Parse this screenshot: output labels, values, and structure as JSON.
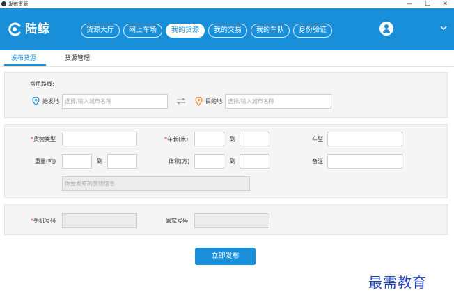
{
  "window": {
    "title": "发布货源",
    "minimize": "—",
    "maximize": "☐",
    "close": "✕"
  },
  "header": {
    "logo_text": "陆鲸",
    "nav": [
      {
        "label": "货源大厅",
        "active": false
      },
      {
        "label": "网上车场",
        "active": false
      },
      {
        "label": "我的货源",
        "active": true
      },
      {
        "label": "我的交易",
        "active": false
      },
      {
        "label": "我的车队",
        "active": false
      },
      {
        "label": "身份验证",
        "active": false
      }
    ]
  },
  "subtabs": {
    "publish": "发布货源",
    "manage": "货源管理"
  },
  "route": {
    "title": "常用路线:",
    "origin_label": "始发地",
    "origin_placeholder": "选择/输入城市名称",
    "dest_label": "目的地",
    "dest_placeholder": "选择/输入城市名称"
  },
  "cargo": {
    "req": "*",
    "type_label": "货物类型",
    "length_label": "车长(米)",
    "to": "到",
    "vehicle_label": "车型",
    "weight_label": "重量(吨)",
    "volume_label": "体积(方)",
    "note_label": "备注",
    "info_placeholder": "你要发布的货物信息"
  },
  "contact": {
    "req": "*",
    "mobile_label": "手机号码",
    "phone_label": "固定号码"
  },
  "submit_label": "立即发布",
  "watermark": "最需教育",
  "colors": {
    "brand": "#1a8fd9",
    "required": "#e03030",
    "origin_pin": "#1a8fd9",
    "dest_pin": "#f08a24",
    "watermark": "#2344b8"
  }
}
